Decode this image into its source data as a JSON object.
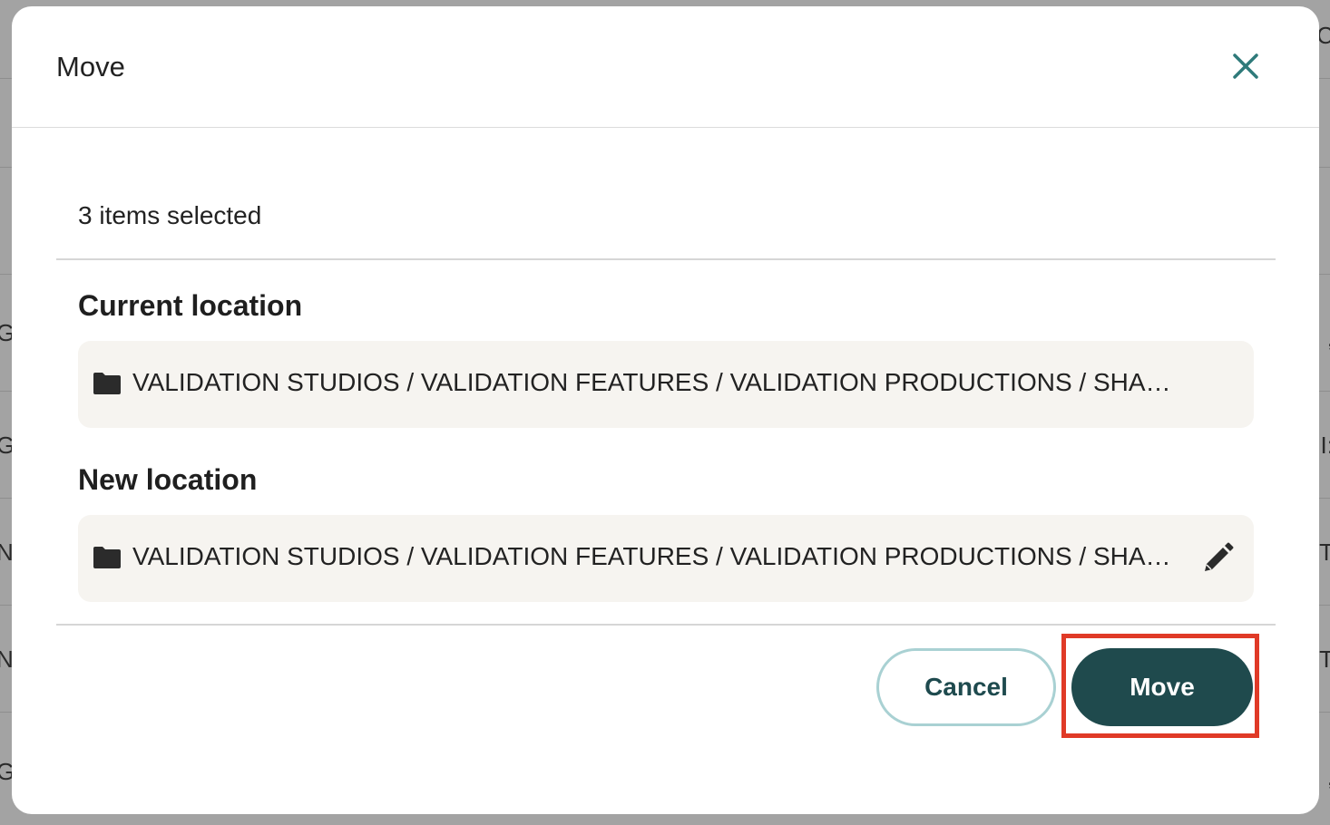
{
  "dialog": {
    "title": "Move",
    "selected_count": "3 items selected",
    "current_location": {
      "heading": "Current location",
      "path": "VALIDATION STUDIOS / VALIDATION FEATURES / VALIDATION PRODUCTIONS / SHADOW FR..."
    },
    "new_location": {
      "heading": "New location",
      "path": "VALIDATION STUDIOS / VALIDATION FEATURES / VALIDATION PRODUCTIONS / SHADO..."
    },
    "buttons": {
      "cancel": "Cancel",
      "move": "Move"
    }
  },
  "icons": {
    "close": "close-icon",
    "folder": "folder-icon",
    "edit": "pencil-icon"
  },
  "colors": {
    "primary": "#1f4a4d",
    "close_icon": "#2f7a7a",
    "cancel_border": "#a9d1d3",
    "location_bg": "#f6f4f0",
    "highlight": "#e03a27"
  },
  "background_fragments": {
    "left": [
      "G.",
      "G",
      "N",
      "N",
      "G"
    ],
    "right": [
      "C",
      ",",
      "I:",
      "T",
      "T",
      ","
    ]
  }
}
